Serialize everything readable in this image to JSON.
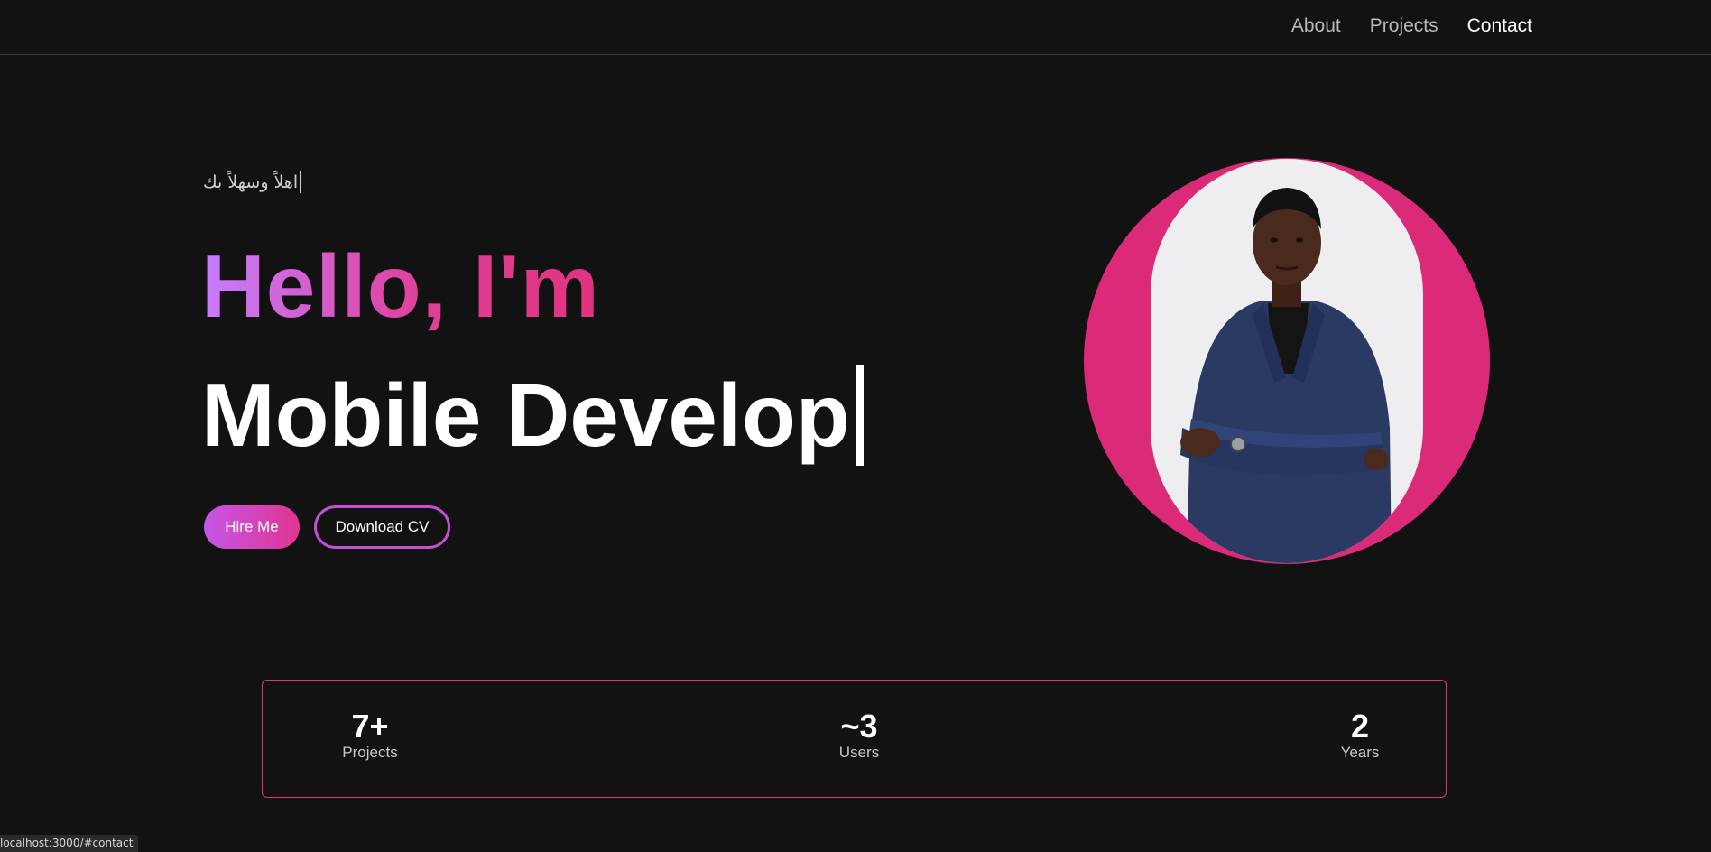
{
  "nav": {
    "items": [
      {
        "label": "About"
      },
      {
        "label": "Projects"
      },
      {
        "label": "Contact"
      }
    ]
  },
  "hero": {
    "greeting": "اهلاً وسهلاً بك",
    "hello": "Hello, I'm",
    "role": "Mobile Develop",
    "hire_label": "Hire Me",
    "cv_label": "Download CV"
  },
  "stats": [
    {
      "value": "7+",
      "label": "Projects"
    },
    {
      "value": "~3",
      "label": "Users"
    },
    {
      "value": "2",
      "label": "Years"
    }
  ],
  "status_bar": {
    "url": "localhost:3000/#contact"
  },
  "colors": {
    "background": "#121212",
    "accent_pink": "#e0337f",
    "accent_purple": "#c77dff"
  }
}
